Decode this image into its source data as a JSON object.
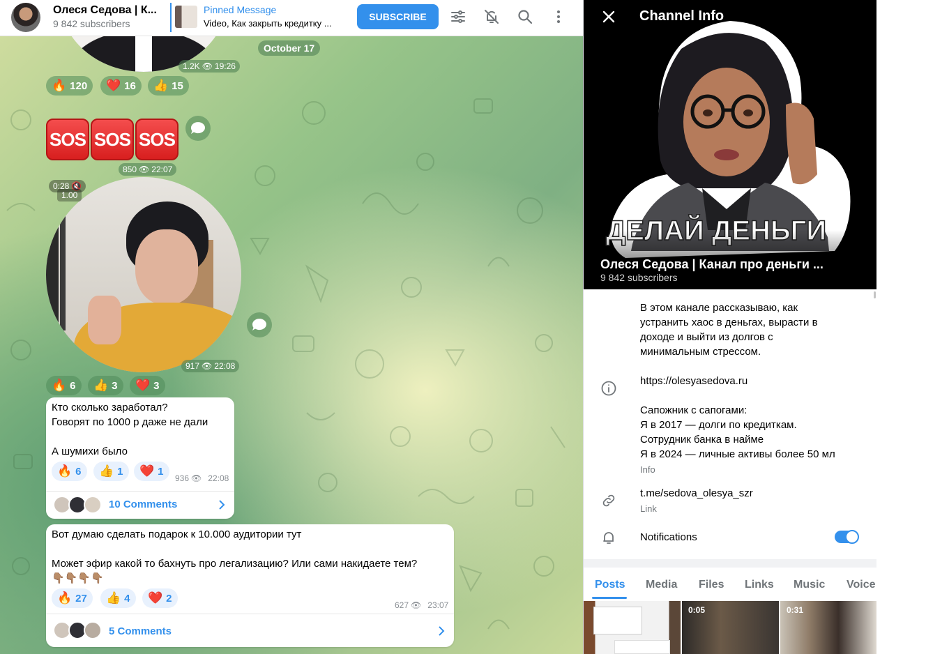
{
  "header": {
    "channel_title": "Олеся Седова | К...",
    "subscribers": "9 842 subscribers",
    "pinned_title": "Pinned Message",
    "pinned_text": "Video, Как закрыть кредитку ...",
    "subscribe_label": "SUBSCRIBE",
    "icons": [
      "filter-icon",
      "mute-icon",
      "search-icon",
      "more-icon"
    ]
  },
  "chat": {
    "date_pill": "October 17",
    "msg1": {
      "views": "1.2K",
      "time": "19:26",
      "reactions": [
        {
          "emoji": "🔥",
          "count": "120"
        },
        {
          "emoji": "❤️",
          "count": "16"
        },
        {
          "emoji": "👍",
          "count": "15"
        }
      ]
    },
    "msg2": {
      "sos": [
        "SOS",
        "SOS",
        "SOS"
      ],
      "views": "850",
      "time": "22:07"
    },
    "msg3": {
      "video_duration": "0:28",
      "playback_speed": "1.00",
      "views": "917",
      "time": "22:08",
      "reactions": [
        {
          "emoji": "🔥",
          "count": "6"
        },
        {
          "emoji": "👍",
          "count": "3"
        },
        {
          "emoji": "❤️",
          "count": "3"
        }
      ]
    },
    "msg4": {
      "text": "Кто сколько заработал?\nГоворят по 1000 р даже не дали\n\nА шумихи было",
      "reactions": [
        {
          "emoji": "🔥",
          "count": "6"
        },
        {
          "emoji": "👍",
          "count": "1"
        },
        {
          "emoji": "❤️",
          "count": "1"
        }
      ],
      "views": "936",
      "time": "22:08",
      "comments": "10 Comments"
    },
    "msg5": {
      "text": "Вот думаю сделать подарок к 10.000 аудитории тут\n\nМожет эфир какой то бахнуть про легализацию? Или сами накидаете тем?\n👇🏽👇🏽👇🏽👇🏽",
      "reactions": [
        {
          "emoji": "🔥",
          "count": "27"
        },
        {
          "emoji": "👍",
          "count": "4"
        },
        {
          "emoji": "❤️",
          "count": "2"
        }
      ],
      "views": "627",
      "time": "23:07",
      "comments": "5 Comments"
    }
  },
  "info": {
    "title": "Channel Info",
    "hero_caption": "ДЕЛАЙ ДЕНЬГИ",
    "name": "Олеся Седова | Канал про деньги ...",
    "subscribers": "9 842 subscribers",
    "description": "В этом канале рассказываю, как\nустранить хаос в деньгах, вырасти в\nдоходе и выйти из долгов с\nминимальным стрессом.",
    "website": "https://olesyasedova.ru",
    "bio": "Сапожник с сапогами:\nЯ в 2017 — долги по кредиткам.\nСотрудник банка в найме\nЯ в 2024 — личные активы более 50 мл",
    "info_label": "Info",
    "link": "t.me/sedova_olesya_szr",
    "link_label": "Link",
    "notifications_label": "Notifications",
    "notifications_on": true,
    "tabs": [
      "Posts",
      "Media",
      "Files",
      "Links",
      "Music",
      "Voice"
    ],
    "active_tab": "Posts",
    "thumbs": [
      {
        "duration": ""
      },
      {
        "duration": "0:05"
      },
      {
        "duration": "0:31"
      }
    ]
  },
  "colors": {
    "accent": "#3390ec",
    "header_bg": "#ffffff",
    "hero_bg": "#000000"
  }
}
